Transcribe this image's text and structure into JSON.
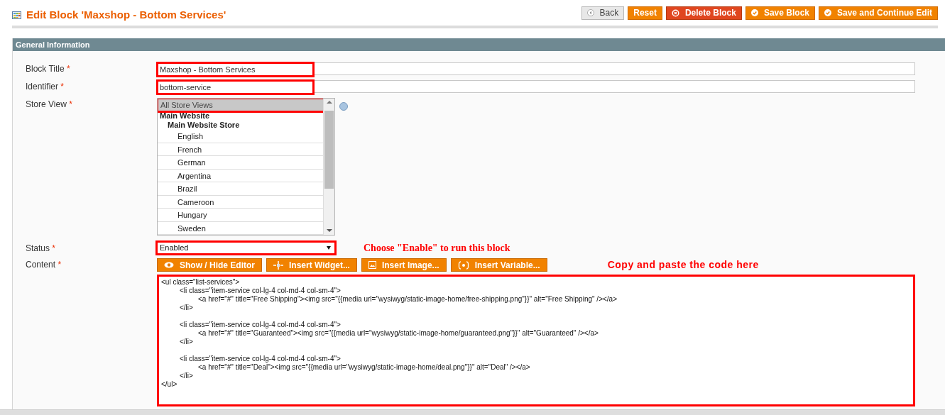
{
  "page_title": "Edit Block 'Maxshop - Bottom Services'",
  "header_buttons": [
    {
      "label": "Back",
      "kind": "back"
    },
    {
      "label": "Reset",
      "kind": "plain"
    },
    {
      "label": "Delete Block",
      "kind": "delete"
    },
    {
      "label": "Save Block",
      "kind": "save"
    },
    {
      "label": "Save and Continue Edit",
      "kind": "save"
    }
  ],
  "section_title": "General Information",
  "block_title": {
    "label": "Block Title",
    "required": "*",
    "value": "Maxshop - Bottom Services",
    "highlighted": true
  },
  "identifier": {
    "label": "Identifier",
    "required": "*",
    "value": "bottom-service",
    "highlighted": true
  },
  "store_view": {
    "label": "Store View",
    "required": "*",
    "highlighted": true,
    "options": [
      {
        "label": "All Store Views",
        "kind": "option",
        "selected": true
      },
      {
        "label": "Main Website",
        "kind": "group",
        "children": [
          {
            "label": "Main Website Store",
            "kind": "group",
            "children": [
              {
                "label": "English",
                "kind": "option",
                "selected": false
              },
              {
                "label": "French",
                "kind": "option",
                "selected": false
              },
              {
                "label": "German",
                "kind": "option",
                "selected": false
              },
              {
                "label": "Argentina",
                "kind": "option",
                "selected": false
              },
              {
                "label": "Brazil",
                "kind": "option",
                "selected": false
              },
              {
                "label": "Cameroon",
                "kind": "option",
                "selected": false
              },
              {
                "label": "Hungary",
                "kind": "option",
                "selected": false
              },
              {
                "label": "Sweden",
                "kind": "option",
                "selected": false
              }
            ]
          }
        ]
      }
    ]
  },
  "status": {
    "label": "Status",
    "required": "*",
    "value": "Enabled",
    "highlighted": true,
    "annotation": "Choose \"Enable\" to run this block"
  },
  "content": {
    "label": "Content",
    "required": "*",
    "highlighted": true,
    "annotation": "Copy and paste the code here",
    "editor_buttons": [
      {
        "label": "Show / Hide Editor",
        "kind": "eye"
      },
      {
        "label": "Insert Widget...",
        "kind": "widget"
      },
      {
        "label": "Insert Image...",
        "kind": "image"
      },
      {
        "label": "Insert Variable...",
        "kind": "variable"
      }
    ],
    "value": "<ul class=\"list-services\">\n\t<li class=\"item-service col-lg-4 col-md-4 col-sm-4\">\n\t\t<a href=\"#\" title=\"Free Shipping\"><img src=\"{{media url=\"wysiwyg/static-image-home/free-shipping.png\"}}\" alt=\"Free Shipping\" /></a>\n\t</li>\n\n\t<li class=\"item-service col-lg-4 col-md-4 col-sm-4\">\n\t\t<a href=\"#\" title=\"Guaranteed\"><img src=\"{{media url=\"wysiwyg/static-image-home/guaranteed.png\"}}\" alt=\"Guaranteed\" /></a>\n\t</li>\n\n\t<li class=\"item-service col-lg-4 col-md-4 col-sm-4\">\n\t\t<a href=\"#\" title=\"Deal\"><img src=\"{{media url=\"wysiwyg/static-image-home/deal.png\"}}\" alt=\"Deal\" /></a>\n\t</li>\n</ul>"
  }
}
